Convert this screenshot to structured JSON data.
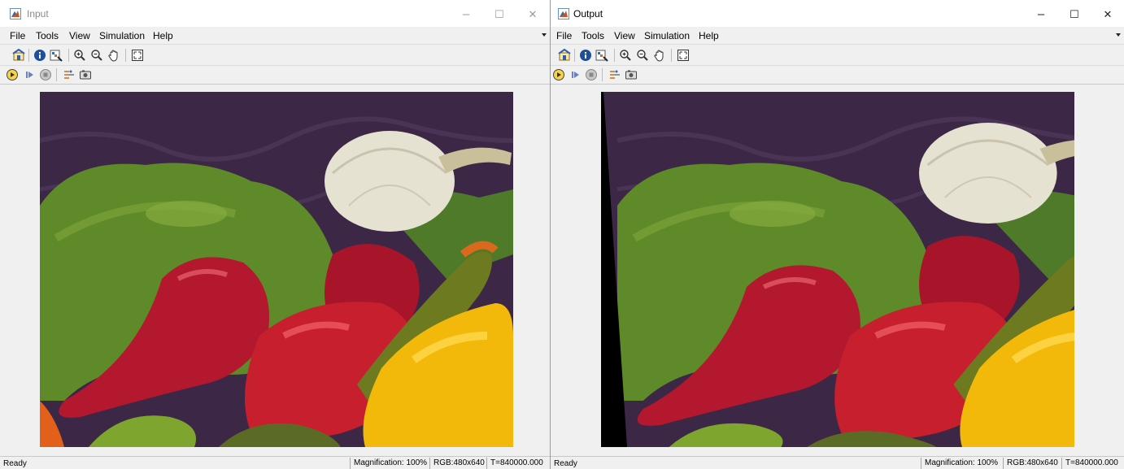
{
  "windows": [
    {
      "title": "Input",
      "menu": [
        "File",
        "Tools",
        "View",
        "Simulation",
        "Help"
      ],
      "status": {
        "state": "Ready",
        "magnification": "Magnification: 100%",
        "rgb": "RGB:480x640",
        "time": "T=840000.000"
      }
    },
    {
      "title": "Output",
      "menu": [
        "File",
        "Tools",
        "View",
        "Simulation",
        "Help"
      ],
      "status": {
        "state": "Ready",
        "magnification": "Magnification: 100%",
        "rgb": "RGB:480x640",
        "time": "T=840000.000"
      }
    }
  ],
  "window_buttons": {
    "minimize": "–",
    "maximize": "☐",
    "close": "✕"
  },
  "colors": {
    "chrome": "#f0f0f0",
    "titlebar": "#ffffff",
    "background_cloth": "#3c2846",
    "pepper_green": "#5f8a2a",
    "pepper_red": "#b3182e",
    "pepper_yellow": "#f2b90a",
    "onion": "#e6e2d2"
  }
}
